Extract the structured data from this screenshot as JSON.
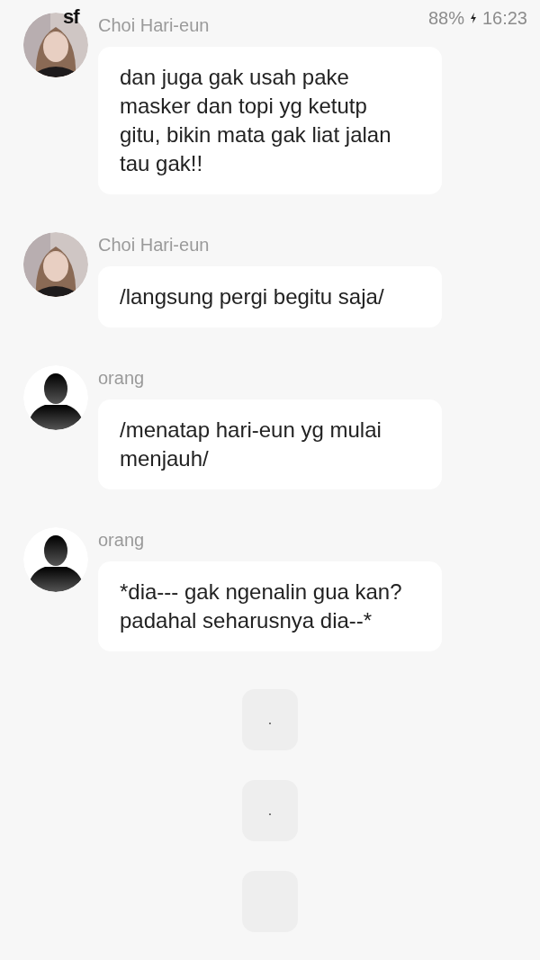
{
  "status_bar": {
    "app_logo": "sf",
    "battery": "88%",
    "time": "16:23"
  },
  "messages": [
    {
      "kind": "photo_chat",
      "sender": "Choi Hari-eun",
      "text": "dan juga gak usah pake masker dan topi yg ketutp gitu, bikin mata gak liat jalan tau gak!!"
    },
    {
      "kind": "photo_chat",
      "sender": "Choi Hari-eun",
      "text": "/langsung pergi begitu saja/"
    },
    {
      "kind": "silhouette_chat",
      "sender": "orang",
      "text": "/menatap hari-eun yg mulai menjauh/"
    },
    {
      "kind": "silhouette_chat",
      "sender": "orang",
      "text": "*dia--- gak ngenalin gua kan? padahal seharusnya dia--*"
    },
    {
      "kind": "narration",
      "text": "."
    },
    {
      "kind": "narration",
      "text": "."
    },
    {
      "kind": "narration"
    }
  ]
}
